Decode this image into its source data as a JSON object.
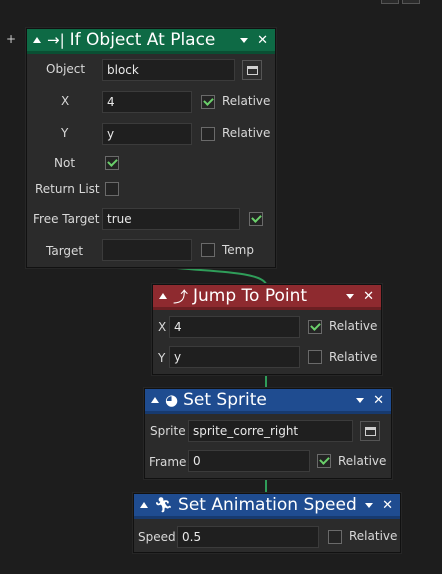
{
  "canvas": {
    "add_symbol": "+"
  },
  "if_object": {
    "title": "If Object At Place",
    "icon": "→|",
    "object_label": "Object",
    "object_value": "block",
    "x_label": "X",
    "x_value": "4",
    "x_relative_label": "Relative",
    "x_relative": true,
    "y_label": "Y",
    "y_value": "y",
    "y_relative_label": "Relative",
    "y_relative": false,
    "not_label": "Not",
    "not_checked": true,
    "return_list_label": "Return List",
    "return_list_checked": false,
    "free_target_label": "Free Target",
    "free_target_value": "true",
    "free_target_checked": true,
    "target_label": "Target",
    "target_value": "",
    "temp_label": "Temp",
    "temp_checked": false
  },
  "jump": {
    "title": "Jump To Point",
    "x_label": "X",
    "x_value": "4",
    "x_relative_label": "Relative",
    "x_relative": true,
    "y_label": "Y",
    "y_value": "y",
    "y_relative_label": "Relative",
    "y_relative": false
  },
  "set_sprite": {
    "title": "Set Sprite",
    "sprite_label": "Sprite",
    "sprite_value": "sprite_corre_right",
    "frame_label": "Frame",
    "frame_value": "0",
    "frame_relative_label": "Relative",
    "frame_relative": true
  },
  "anim_speed": {
    "title": "Set Animation Speed",
    "speed_label": "Speed",
    "speed_value": "0.5",
    "speed_relative_label": "Relative",
    "speed_relative": false
  },
  "colors": {
    "green": "#0e6a45",
    "red": "#8e2a2f",
    "blue": "#1f4c90",
    "connector": "#2f9d59"
  },
  "icons": [
    "collapse-triangle-icon",
    "dropdown-icon",
    "close-icon",
    "object-picker-icon",
    "checkmark-icon"
  ]
}
